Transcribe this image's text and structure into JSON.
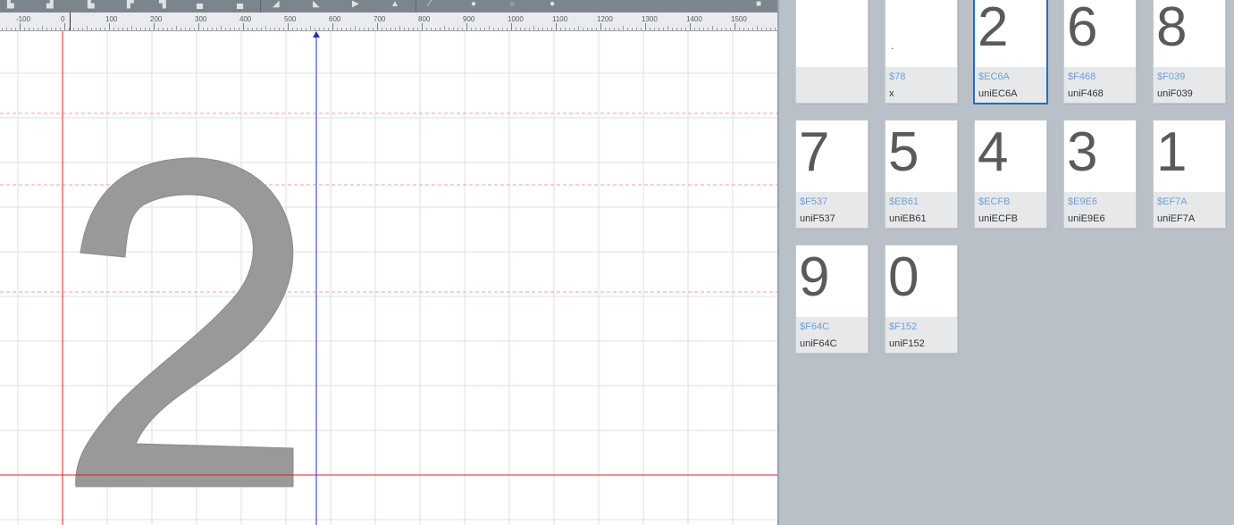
{
  "ruler": {
    "labels": [
      "-100",
      "0",
      "100",
      "200",
      "300",
      "400",
      "500",
      "600",
      "700",
      "800",
      "900",
      "1000",
      "1100",
      "1200",
      "1300",
      "1400",
      "1500"
    ]
  },
  "editor": {
    "glyph_char": "2",
    "fill_color": "#999999",
    "baseline_color": "#e02020",
    "advance_color": "#2030c0",
    "guide_color": "#f0a0a0",
    "grid_color": "#dcdcf0"
  },
  "glyphs": [
    {
      "char": "",
      "code": "",
      "name": "",
      "selected": false
    },
    {
      "char": ".",
      "code": "$78",
      "name": "x",
      "selected": false
    },
    {
      "char": "2",
      "code": "$EC6A",
      "name": "uniEC6A",
      "selected": true
    },
    {
      "char": "6",
      "code": "$F468",
      "name": "uniF468",
      "selected": false
    },
    {
      "char": "8",
      "code": "$F039",
      "name": "uniF039",
      "selected": false
    },
    {
      "char": "7",
      "code": "$F537",
      "name": "uniF537",
      "selected": false
    },
    {
      "char": "5",
      "code": "$EB61",
      "name": "uniEB61",
      "selected": false
    },
    {
      "char": "4",
      "code": "$ECFB",
      "name": "uniECFB",
      "selected": false
    },
    {
      "char": "3",
      "code": "$E9E6",
      "name": "uniE9E6",
      "selected": false
    },
    {
      "char": "1",
      "code": "$EF7A",
      "name": "uniEF7A",
      "selected": false
    },
    {
      "char": "9",
      "code": "$F64C",
      "name": "uniF64C",
      "selected": false
    },
    {
      "char": "0",
      "code": "$F152",
      "name": "uniF152",
      "selected": false
    }
  ],
  "toolbar": {
    "icons": [
      "align-left-icon",
      "align-center-icon",
      "align-right-icon",
      "align-top-icon",
      "align-middle-icon",
      "align-bottom-icon",
      "distribute-icon",
      "flip-horizontal-icon",
      "flip-vertical-icon",
      "play-icon",
      "mirror-icon",
      "pen-icon",
      "node-icon",
      "circle-icon",
      "dot-icon"
    ]
  }
}
